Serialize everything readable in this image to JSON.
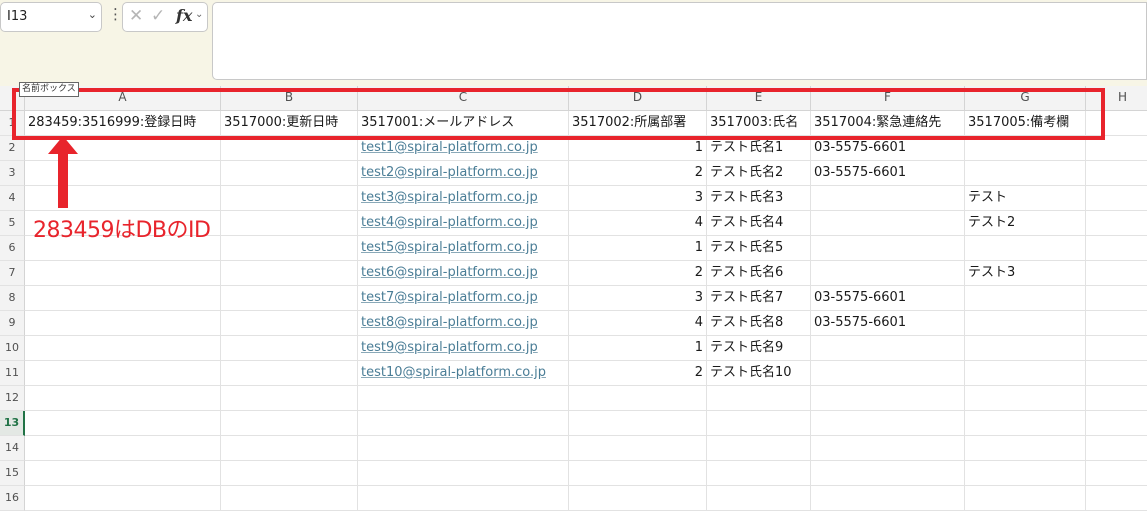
{
  "name_box": {
    "value": "I13"
  },
  "formula_bar": {
    "fx_label": "fx",
    "value": ""
  },
  "tooltip": "名前ボックス",
  "columns": [
    "A",
    "B",
    "C",
    "D",
    "E",
    "F",
    "G",
    "H"
  ],
  "rows": [
    "1",
    "2",
    "3",
    "4",
    "5",
    "6",
    "7",
    "8",
    "9",
    "10",
    "11",
    "12",
    "13",
    "14",
    "15",
    "16"
  ],
  "selected_row": "13",
  "table": [
    [
      "283459:3516999:登録日時",
      "3517000:更新日時",
      "3517001:メールアドレス",
      "3517002:所属部署",
      "3517003:氏名",
      "3517004:緊急連絡先",
      "3517005:備考欄",
      ""
    ],
    [
      "",
      "",
      "test1@spiral-platform.co.jp",
      "1",
      "テスト氏名1",
      "03-5575-6601",
      "",
      ""
    ],
    [
      "",
      "",
      "test2@spiral-platform.co.jp",
      "2",
      "テスト氏名2",
      "03-5575-6601",
      "",
      ""
    ],
    [
      "",
      "",
      "test3@spiral-platform.co.jp",
      "3",
      "テスト氏名3",
      "",
      "テスト",
      ""
    ],
    [
      "",
      "",
      "test4@spiral-platform.co.jp",
      "4",
      "テスト氏名4",
      "",
      "テスト2",
      ""
    ],
    [
      "",
      "",
      "test5@spiral-platform.co.jp",
      "1",
      "テスト氏名5",
      "",
      "",
      ""
    ],
    [
      "",
      "",
      "test6@spiral-platform.co.jp",
      "2",
      "テスト氏名6",
      "",
      "テスト3",
      ""
    ],
    [
      "",
      "",
      "test7@spiral-platform.co.jp",
      "3",
      "テスト氏名7",
      "03-5575-6601",
      "",
      ""
    ],
    [
      "",
      "",
      "test8@spiral-platform.co.jp",
      "4",
      "テスト氏名8",
      "03-5575-6601",
      "",
      ""
    ],
    [
      "",
      "",
      "test9@spiral-platform.co.jp",
      "1",
      "テスト氏名9",
      "",
      "",
      ""
    ],
    [
      "",
      "",
      "test10@spiral-platform.co.jp",
      "2",
      "テスト氏名10",
      "",
      "",
      ""
    ]
  ],
  "annotation": {
    "text": "283459はDBのID",
    "color": "#e8242c"
  }
}
